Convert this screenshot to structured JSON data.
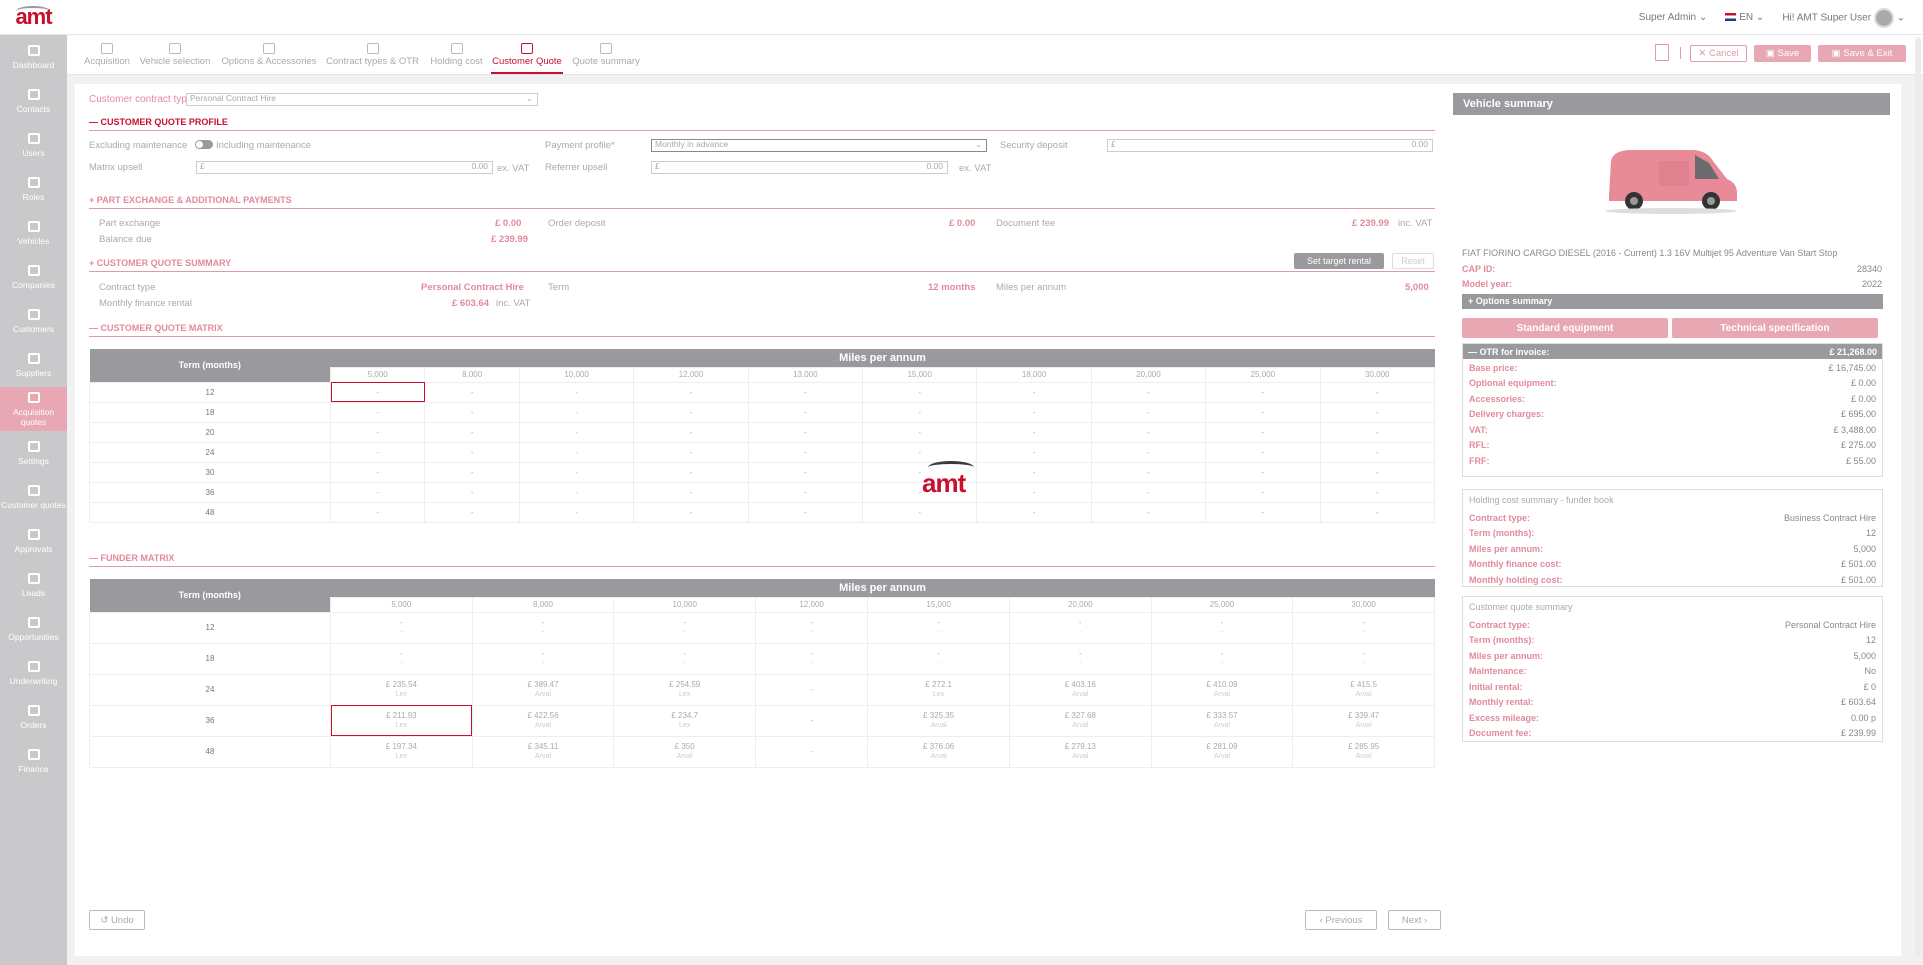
{
  "app": {
    "logo": "amt"
  },
  "header": {
    "role": "Super Admin",
    "lang": "EN",
    "greeting": "Hi! AMT Super User"
  },
  "sidebar": [
    {
      "label": "Dashboard",
      "icon": "dashboard-icon"
    },
    {
      "label": "Contacts",
      "icon": "contacts-icon"
    },
    {
      "label": "Users",
      "icon": "users-icon"
    },
    {
      "label": "Roles",
      "icon": "roles-icon"
    },
    {
      "label": "Vehicles",
      "icon": "vehicles-icon"
    },
    {
      "label": "Companies",
      "icon": "companies-icon"
    },
    {
      "label": "Customers",
      "icon": "customers-icon"
    },
    {
      "label": "Suppliers",
      "icon": "suppliers-icon"
    },
    {
      "label": "Acquisition quotes",
      "icon": "acquisition-icon"
    },
    {
      "label": "Settings",
      "icon": "settings-icon"
    },
    {
      "label": "Customer quotes",
      "icon": "customer-quotes-icon"
    },
    {
      "label": "Approvals",
      "icon": "approvals-icon"
    },
    {
      "label": "Leads",
      "icon": "leads-icon"
    },
    {
      "label": "Opportunities",
      "icon": "opportunities-icon"
    },
    {
      "label": "Underwriting",
      "icon": "underwriting-icon"
    },
    {
      "label": "Orders",
      "icon": "orders-icon"
    },
    {
      "label": "Finance",
      "icon": "finance-icon"
    }
  ],
  "steps": [
    "Acquisition",
    "Vehicle selection",
    "Options & Accessories",
    "Contract types & OTR",
    "Holding cost",
    "Customer Quote",
    "Quote summary"
  ],
  "actions": {
    "cancel": "Cancel",
    "save": "Save",
    "save_exit": "Save & Exit"
  },
  "form": {
    "contract_type_label": "Customer contract type :",
    "contract_type_value": "Personal Contract Hire",
    "profile_title": "CUSTOMER QUOTE PROFILE",
    "excl_maint": "Excluding maintenance",
    "incl_maint": "Including maintenance",
    "payment_profile_label": "Payment profile*",
    "payment_profile_value": "Monthly in advance",
    "security_deposit_label": "Security deposit",
    "security_deposit_cur": "£",
    "security_deposit_value": "0.00",
    "matrix_upsell_label": "Matrix upsell",
    "matrix_upsell_cur": "£",
    "matrix_upsell_value": "0.00",
    "ex_vat": "ex. VAT",
    "referrer_upsell_label": "Referrer upsell",
    "referrer_upsell_cur": "£",
    "referrer_upsell_value": "0.00"
  },
  "part_exchange": {
    "title": "PART EXCHANGE & ADDITIONAL PAYMENTS",
    "part_exchange_label": "Part exchange",
    "part_exchange_value": "£ 0.00",
    "order_deposit_label": "Order deposit",
    "order_deposit_value": "£ 0.00",
    "document_fee_label": "Document fee",
    "document_fee_value": "£ 239.99",
    "inc_vat": "inc. VAT",
    "balance_due_label": "Balance due",
    "balance_due_value": "£ 239.99"
  },
  "summary": {
    "title": "CUSTOMER QUOTE SUMMARY",
    "set_target": "Set target rental",
    "reset": "Reset",
    "contract_type_label": "Contract type",
    "contract_type_value": "Personal Contract Hire",
    "term_label": "Term",
    "term_value": "12 months",
    "mpa_label": "Miles per annum",
    "mpa_value": "5,000",
    "monthly_label": "Monthly finance rental",
    "monthly_value": "£ 603.64",
    "inc_vat": "inc. VAT"
  },
  "cq_matrix": {
    "title": "CUSTOMER QUOTE MATRIX",
    "header": "Miles per annum",
    "term_header": "Term (months)",
    "miles": [
      "5,000",
      "8,000",
      "10,000",
      "12,000",
      "13,000",
      "15,000",
      "18,000",
      "20,000",
      "25,000",
      "30,000"
    ],
    "terms": [
      "12",
      "18",
      "20",
      "24",
      "30",
      "36",
      "48"
    ],
    "empty": "-"
  },
  "funder_matrix": {
    "title": "FUNDER MATRIX",
    "header": "Miles per annum",
    "term_header": "Term (months)",
    "miles": [
      "5,000",
      "8,000",
      "10,000",
      "12,000",
      "15,000",
      "20,000",
      "25,000",
      "30,000"
    ],
    "rows": [
      {
        "term": "12",
        "cells": [
          [
            "-",
            "-"
          ],
          [
            "-",
            "-"
          ],
          [
            "-",
            "-"
          ],
          [
            "-",
            "-"
          ],
          [
            "-",
            "-"
          ],
          [
            "-",
            "-"
          ],
          [
            "-",
            "-"
          ],
          [
            "-",
            "-"
          ]
        ]
      },
      {
        "term": "18",
        "cells": [
          [
            "-",
            "-"
          ],
          [
            "-",
            "-"
          ],
          [
            "-",
            "-"
          ],
          [
            "-",
            "-"
          ],
          [
            "-",
            "-"
          ],
          [
            "-",
            "-"
          ],
          [
            "-",
            "-"
          ],
          [
            "-",
            "-"
          ]
        ]
      },
      {
        "term": "24",
        "cells": [
          [
            "£ 235.54",
            "Lex"
          ],
          [
            "£ 389.47",
            "Arval"
          ],
          [
            "£ 254.59",
            "Lex"
          ],
          [
            "-",
            ""
          ],
          [
            "£ 272.1",
            "Lex"
          ],
          [
            "£ 403.16",
            "Arval"
          ],
          [
            "£ 410.09",
            "Arval"
          ],
          [
            "£ 415.5",
            "Arval"
          ]
        ]
      },
      {
        "term": "36",
        "cells": [
          [
            "£ 211.93",
            "Lex"
          ],
          [
            "£ 422.56",
            "Arval"
          ],
          [
            "£ 234.7",
            "Lex"
          ],
          [
            "-",
            ""
          ],
          [
            "£ 325.35",
            "Arval"
          ],
          [
            "£ 327.68",
            "Arval"
          ],
          [
            "£ 333.57",
            "Arval"
          ],
          [
            "£ 339.47",
            "Arval"
          ]
        ]
      },
      {
        "term": "48",
        "cells": [
          [
            "£ 197.34",
            "Lex"
          ],
          [
            "£ 345.11",
            "Arval"
          ],
          [
            "£ 350",
            "Arval"
          ],
          [
            "-",
            ""
          ],
          [
            "£ 376.06",
            "Arval"
          ],
          [
            "£ 279.13",
            "Arval"
          ],
          [
            "£ 281.09",
            "Arval"
          ],
          [
            "£ 285.95",
            "Arval"
          ]
        ]
      }
    ]
  },
  "bottom": {
    "undo": "Undo",
    "previous": "Previous",
    "next": "Next"
  },
  "vehicle": {
    "title": "Vehicle summary",
    "name": "FIAT FIORINO CARGO DIESEL (2016 - Current) 1.3 16V Multijet 95 Adventure Van Start Stop",
    "cap_id_label": "CAP ID:",
    "cap_id": "28340",
    "model_year_label": "Model year:",
    "model_year": "2022",
    "options_summary": "Options summary",
    "std_equipment": "Standard equipment",
    "tech_spec": "Technical specification",
    "otr_label": "OTR for invoice:",
    "otr_value": "£ 21,268.00",
    "otr_rows": [
      {
        "k": "Base price:",
        "v": "£ 16,745.00"
      },
      {
        "k": "Optional equipment:",
        "v": "£ 0.00"
      },
      {
        "k": "Accessories:",
        "v": "£ 0.00"
      },
      {
        "k": "Delivery charges:",
        "v": "£ 695.00"
      },
      {
        "k": "VAT:",
        "v": "£ 3,488.00"
      },
      {
        "k": "RFL:",
        "v": "£ 275.00"
      },
      {
        "k": "FRF:",
        "v": "£ 55.00"
      }
    ],
    "holding_title": "Holding cost summary - funder book",
    "holding_rows": [
      {
        "k": "Contract type:",
        "v": "Business Contract Hire"
      },
      {
        "k": "Term (months):",
        "v": "12"
      },
      {
        "k": "Miles per annum:",
        "v": "5,000"
      },
      {
        "k": "Monthly finance cost:",
        "v": "£ 501.00"
      },
      {
        "k": "Monthly holding cost:",
        "v": "£ 501.00"
      }
    ],
    "cq_title": "Customer quote summary",
    "cq_rows": [
      {
        "k": "Contract type:",
        "v": "Personal Contract Hire"
      },
      {
        "k": "Term (months):",
        "v": "12"
      },
      {
        "k": "Miles per annum:",
        "v": "5,000"
      },
      {
        "k": "Maintenance:",
        "v": "No"
      },
      {
        "k": "Initial rental:",
        "v": "£ 0"
      },
      {
        "k": "Monthly rental:",
        "v": "£ 603.64"
      },
      {
        "k": "Excess mileage:",
        "v": "0.00 p"
      },
      {
        "k": "Document fee:",
        "v": "£ 239.99"
      }
    ]
  }
}
